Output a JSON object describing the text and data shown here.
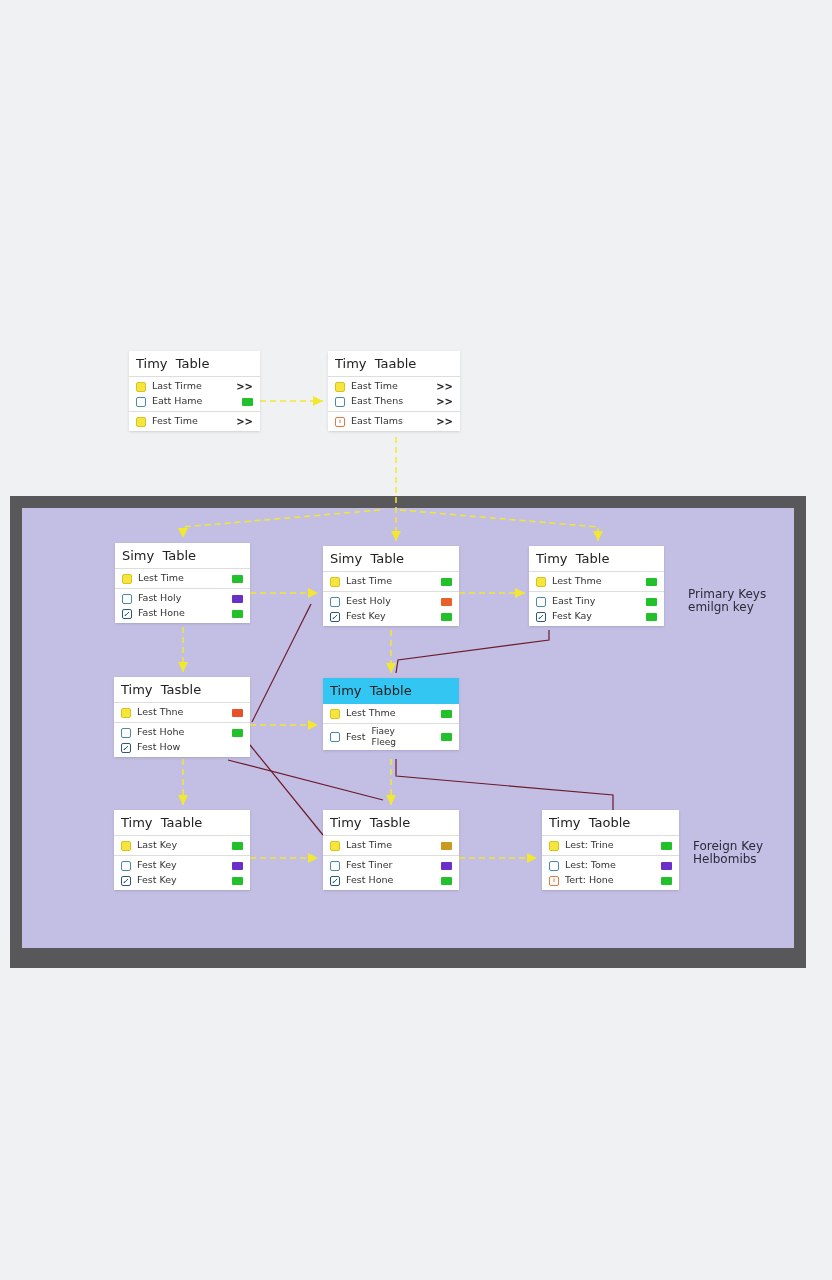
{
  "tables": [
    {
      "title": "Timy  Table",
      "highlighted": false,
      "sections": [
        [
          {
            "name": "Last Tirme",
            "kind": "filled",
            "text": ">>"
          },
          {
            "name": "Eatt Hame",
            "kind": "outline",
            "color": "#22c02a"
          }
        ],
        [
          {
            "name": "Fest Time",
            "kind": "filled",
            "text": ">>"
          }
        ]
      ]
    },
    {
      "title": "Timy  Taable",
      "highlighted": false,
      "sections": [
        [
          {
            "name": "East Time",
            "kind": "filled",
            "text": ">>"
          },
          {
            "name": "East Thens",
            "kind": "outline",
            "text": ">>"
          }
        ],
        [
          {
            "name": "East Tlams",
            "kind": "alert",
            "text": ">>"
          }
        ]
      ]
    },
    {
      "title": "Simy  Table",
      "highlighted": false,
      "sections": [
        [
          {
            "name": "Lest Time",
            "kind": "filled",
            "color": "#22c02a"
          }
        ],
        [
          {
            "name": "Fast Holy",
            "kind": "outline",
            "color": "#6a2fc8"
          },
          {
            "name": "Fast Hone",
            "kind": "edit",
            "color": "#22c02a"
          }
        ]
      ]
    },
    {
      "title": "Simy  Table",
      "highlighted": false,
      "sections": [
        [
          {
            "name": "Last Time",
            "kind": "filled",
            "color": "#22c02a"
          }
        ],
        [
          {
            "name": "Eest Holy",
            "kind": "outline",
            "color": "#e8602a"
          },
          {
            "name": "Fest Key",
            "kind": "edit",
            "color": "#22c02a"
          }
        ]
      ]
    },
    {
      "title": "Timy  Table",
      "highlighted": false,
      "sections": [
        [
          {
            "name": "Lest Thme",
            "kind": "filled",
            "color": "#22c02a"
          }
        ],
        [
          {
            "name": "East Tiny",
            "kind": "outline",
            "color": "#22c02a"
          },
          {
            "name": "Fest Kay",
            "kind": "edit",
            "color": "#22c02a"
          }
        ]
      ]
    },
    {
      "title": "Timy  Tasble",
      "highlighted": false,
      "sections": [
        [
          {
            "name": "Lest Thne",
            "kind": "filled",
            "color": "#e8502a"
          }
        ],
        [
          {
            "name": "Fest Hohe",
            "kind": "outline",
            "color": "#22c02a"
          },
          {
            "name": "Fest How",
            "kind": "edit"
          }
        ]
      ]
    },
    {
      "title": "Timy  Tabble",
      "highlighted": true,
      "sections": [
        [
          {
            "name": "Lest Thme",
            "kind": "filled",
            "color": "#22c02a"
          }
        ],
        [
          {
            "name": "Fest",
            "note": "Fiaey Fleeg",
            "kind": "outline",
            "color": "#22c02a"
          }
        ]
      ]
    },
    {
      "title": "Timy  Taable",
      "highlighted": false,
      "sections": [
        [
          {
            "name": "Last Key",
            "kind": "filled",
            "color": "#22c02a"
          }
        ],
        [
          {
            "name": "Fest Key",
            "kind": "outline",
            "color": "#6a2fc8"
          },
          {
            "name": "Fest Key",
            "kind": "edit",
            "color": "#22c02a"
          }
        ]
      ]
    },
    {
      "title": "Timy  Tasble",
      "highlighted": false,
      "sections": [
        [
          {
            "name": "Last Time",
            "kind": "filled",
            "color": "#c89a20"
          }
        ],
        [
          {
            "name": "Fest Tiner",
            "kind": "outline",
            "color": "#6a2fc8"
          },
          {
            "name": "Fest Hone",
            "kind": "edit",
            "color": "#22c02a"
          }
        ]
      ]
    },
    {
      "title": "Timy  Taoble",
      "highlighted": false,
      "sections": [
        [
          {
            "name": "Lest: Trine",
            "kind": "filled",
            "color": "#22c02a"
          }
        ],
        [
          {
            "name": "Lest: Tome",
            "kind": "outline",
            "color": "#6a2fc8"
          },
          {
            "name": "Tert: Hone",
            "kind": "alert",
            "color": "#22c02a"
          }
        ]
      ]
    }
  ],
  "legends": [
    [
      "Primary Keys",
      "emilgn key"
    ],
    [
      "Foreign Key",
      "Helbomibs"
    ]
  ]
}
